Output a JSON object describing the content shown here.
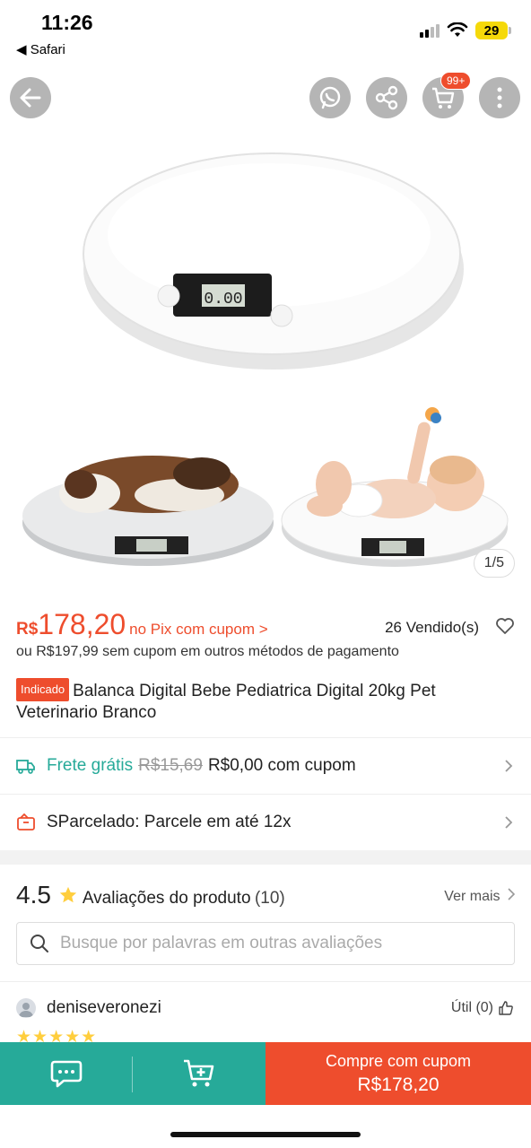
{
  "status": {
    "time": "11:26",
    "back_app": "◀ Safari",
    "battery": "29"
  },
  "topbar": {
    "cart_badge": "99+"
  },
  "gallery": {
    "counter": "1/5"
  },
  "price": {
    "currency": "R$",
    "value": "178,20",
    "note": "no Pix com cupom >",
    "sold": "26 Vendido(s)",
    "alt": "ou R$197,99 sem cupom em outros métodos de pagamento"
  },
  "product": {
    "tag": "Indicado",
    "title": "Balanca Digital Bebe Pediatrica Digital 20kg Pet Veterinario Branco"
  },
  "shipping": {
    "label": "Frete grátis",
    "old_price": "R$15,69",
    "new_price": "R$0,00 com cupom"
  },
  "installments": {
    "label": "SParcelado: Parcele em até 12x"
  },
  "reviews": {
    "rating": "4.5",
    "title": "Avaliações do produto",
    "count": "(10)",
    "see_more": "Ver mais",
    "search_placeholder": "Busque por palavras em outras avaliações",
    "first": {
      "user": "deniseveronezi",
      "useful": "Útil (0)",
      "stars": 5
    }
  },
  "bottom": {
    "buy_line1": "Compre com cupom",
    "buy_line2": "R$178,20"
  },
  "colors": {
    "accent": "#ee4d2d",
    "teal": "#26aa99",
    "star": "#ffce3d"
  },
  "icons": [
    "back-arrow-icon",
    "whatsapp-icon",
    "share-icon",
    "cart-icon",
    "more-icon",
    "heart-icon",
    "truck-icon",
    "wallet-icon",
    "star-icon",
    "search-icon",
    "thumbs-up-icon",
    "chat-icon",
    "add-to-cart-icon",
    "chevron-right-icon"
  ]
}
